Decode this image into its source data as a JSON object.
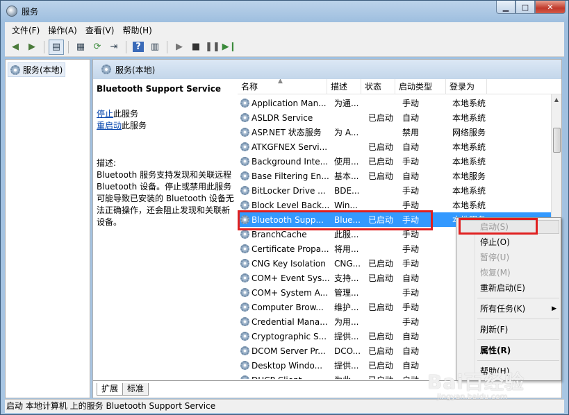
{
  "window": {
    "title": "服务"
  },
  "menu": [
    {
      "label": "文件(F)"
    },
    {
      "label": "操作(A)"
    },
    {
      "label": "查看(V)"
    },
    {
      "label": "帮助(H)"
    }
  ],
  "tree": {
    "root": "服务(本地)"
  },
  "main_header": "服务(本地)",
  "detail": {
    "service_name": "Bluetooth Support Service",
    "stop_link": "停止",
    "stop_suffix": "此服务",
    "restart_link": "重启动",
    "restart_suffix": "此服务",
    "desc_label": "描述:",
    "description": "Bluetooth 服务支持发现和关联远程 Bluetooth 设备。停止或禁用此服务可能导致已安装的 Bluetooth 设备无法正确操作，还会阻止发现和关联新设备。"
  },
  "columns": {
    "name": "名称",
    "desc": "描述",
    "status": "状态",
    "startup": "启动类型",
    "logon": "登录为"
  },
  "rows": [
    {
      "name": "Application Man...",
      "desc": "为通...",
      "status": "",
      "startup": "手动",
      "logon": "本地系统"
    },
    {
      "name": "ASLDR Service",
      "desc": "",
      "status": "已启动",
      "startup": "自动",
      "logon": "本地系统"
    },
    {
      "name": "ASP.NET 状态服务",
      "desc": "为 A...",
      "status": "",
      "startup": "禁用",
      "logon": "网络服务"
    },
    {
      "name": "ATKGFNEX Servi...",
      "desc": "",
      "status": "已启动",
      "startup": "自动",
      "logon": "本地系统"
    },
    {
      "name": "Background Inte...",
      "desc": "使用...",
      "status": "已启动",
      "startup": "手动",
      "logon": "本地系统"
    },
    {
      "name": "Base Filtering En...",
      "desc": "基本...",
      "status": "已启动",
      "startup": "自动",
      "logon": "本地服务"
    },
    {
      "name": "BitLocker Drive ...",
      "desc": "BDE...",
      "status": "",
      "startup": "手动",
      "logon": "本地系统"
    },
    {
      "name": "Block Level Back...",
      "desc": "Win...",
      "status": "",
      "startup": "手动",
      "logon": "本地系统"
    },
    {
      "name": "Bluetooth Supp...",
      "desc": "Blue...",
      "status": "已启动",
      "startup": "手动",
      "logon": "本地服务"
    },
    {
      "name": "BranchCache",
      "desc": "此服...",
      "status": "",
      "startup": "手动",
      "logon": ""
    },
    {
      "name": "Certificate Propa...",
      "desc": "将用...",
      "status": "",
      "startup": "手动",
      "logon": ""
    },
    {
      "name": "CNG Key Isolation",
      "desc": "CNG...",
      "status": "已启动",
      "startup": "手动",
      "logon": ""
    },
    {
      "name": "COM+ Event Sys...",
      "desc": "支持...",
      "status": "已启动",
      "startup": "自动",
      "logon": ""
    },
    {
      "name": "COM+ System A...",
      "desc": "管理...",
      "status": "",
      "startup": "手动",
      "logon": ""
    },
    {
      "name": "Computer Brow...",
      "desc": "维护...",
      "status": "已启动",
      "startup": "手动",
      "logon": ""
    },
    {
      "name": "Credential Mana...",
      "desc": "为用...",
      "status": "",
      "startup": "手动",
      "logon": ""
    },
    {
      "name": "Cryptographic S...",
      "desc": "提供...",
      "status": "已启动",
      "startup": "自动",
      "logon": ""
    },
    {
      "name": "DCOM Server Pr...",
      "desc": "DCO...",
      "status": "已启动",
      "startup": "自动",
      "logon": ""
    },
    {
      "name": "Desktop Windo...",
      "desc": "提供...",
      "status": "已启动",
      "startup": "自动",
      "logon": ""
    },
    {
      "name": "DHCP Client",
      "desc": "为此...",
      "status": "已启动",
      "startup": "自动",
      "logon": ""
    }
  ],
  "tabs": [
    {
      "label": "扩展"
    },
    {
      "label": "标准"
    }
  ],
  "status_bar": "启动 本地计算机 上的服务 Bluetooth Support Service",
  "context_menu": {
    "start": "启动(S)",
    "stop": "停止(O)",
    "pause": "暂停(U)",
    "resume": "恢复(M)",
    "restart": "重新启动(E)",
    "all_tasks": "所有任务(K)",
    "refresh": "刷新(F)",
    "properties": "属性(R)",
    "help": "帮助(H)"
  },
  "watermark": {
    "main": "Bai百经验",
    "sub": "jingyan.baidu.com"
  },
  "colors": {
    "selection": "#3399ff",
    "highlight_box": "#e02020"
  },
  "icons": {
    "back": "arrow-left-icon",
    "forward": "arrow-right-icon",
    "console": "console-tree-icon",
    "play": "play-icon",
    "stop": "stop-icon",
    "pause": "pause-icon",
    "restart": "restart-icon",
    "service": "gear-icon"
  }
}
